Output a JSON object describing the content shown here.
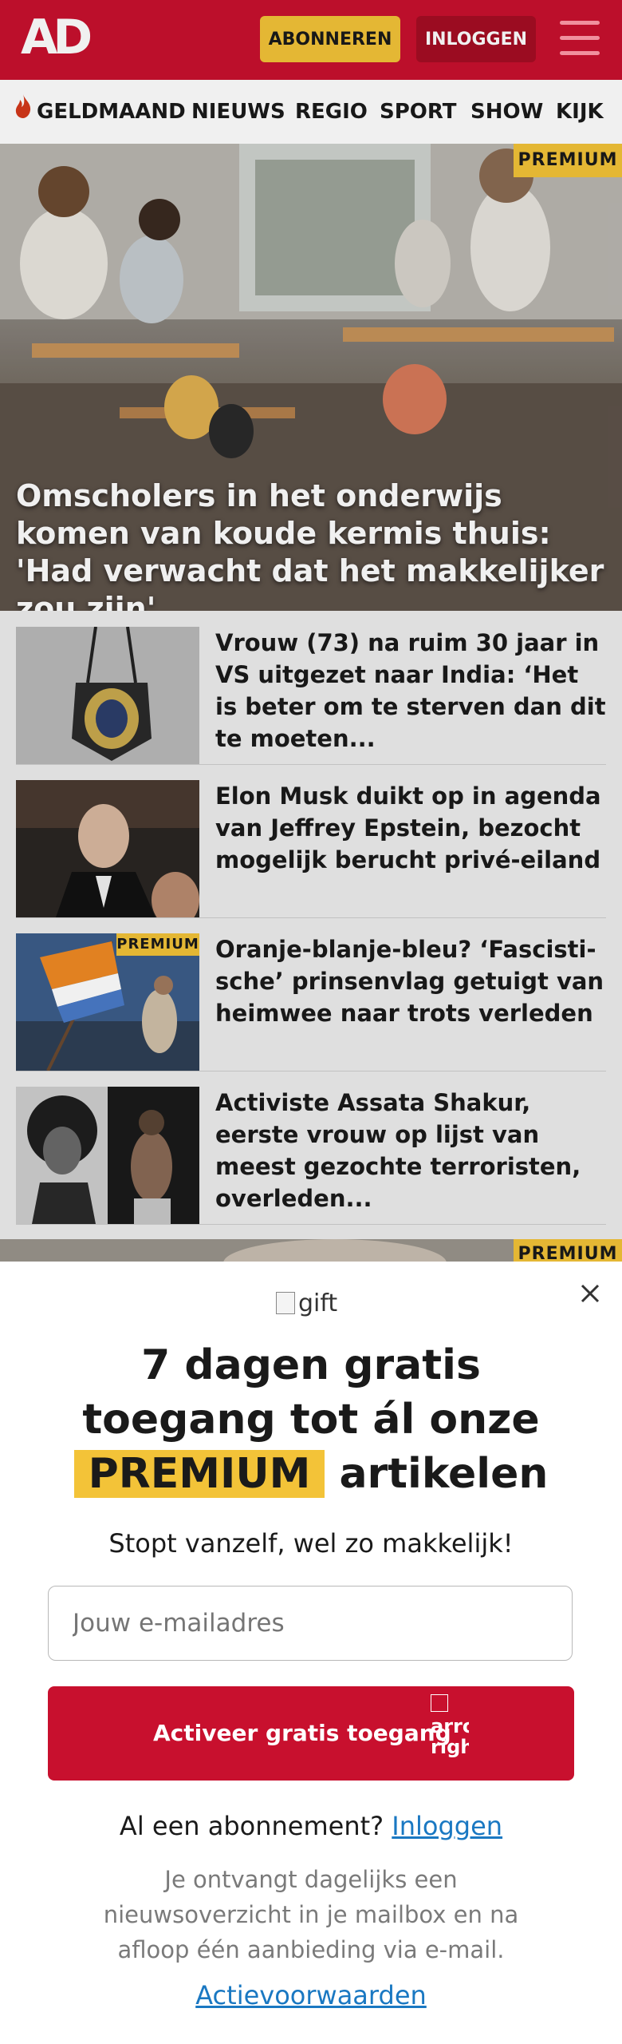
{
  "header": {
    "logo": "AD",
    "subscribe_label": "ABONNEREN",
    "login_label": "INLOGGEN"
  },
  "nav": {
    "items": [
      "GELDMAAND",
      "NIEUWS",
      "REGIO",
      "SPORT",
      "SHOW",
      "KIJK"
    ]
  },
  "hero": {
    "badge": "PREMIUM",
    "title": "Omscholers in het onderwijs komen van koude kermis thuis: 'Had verwacht dat het makkelijker zou zijn'"
  },
  "articles": [
    {
      "title": "Vrouw (73) na ruim 30 jaar in VS uitgezet naar India: ‘Het is beter om te sterven dan dit te moeten...",
      "premium": false
    },
    {
      "title": "Elon Musk duikt op in agenda van Jeffrey Epstein, bezocht mogelijk berucht privé-eiland",
      "premium": false
    },
    {
      "title": "Oranje-blanje-bleu? ‘Fascisti­sche’ prinsenvlag getuigt van heimwee naar trots verleden",
      "premium": true,
      "badge": "PREMIUM"
    },
    {
      "title": "Activiste Assata Shakur, eerste vrouw op lijst van meest gezochte terroristen, overleden...",
      "premium": false
    }
  ],
  "teaser": {
    "badge": "PREMIUM"
  },
  "modal": {
    "gift_alt": "gift",
    "title_line1": "7 dagen gratis",
    "title_line2": "toegang tot ál onze",
    "title_highlight": "PREMIUM",
    "title_line3_rest": "artikelen",
    "subtitle": "Stopt vanzelf, wel zo makkelijk!",
    "email_placeholder": "Jouw e-mailadres",
    "cta_label": "Activeer gratis toegang",
    "cta_icon_alt": "arrow right",
    "login_prompt": "Al een abonnement?",
    "login_link": "Inloggen",
    "note": "Je ontvangt dagelijks een nieuwsoverzicht in je mailbox en na afloop één aanbieding via e-mail.",
    "terms_link": "Actievoorwaarden"
  },
  "colors": {
    "brand_red": "#c8102e",
    "premium_yellow": "#f3c338",
    "link_blue": "#1a78c2"
  }
}
